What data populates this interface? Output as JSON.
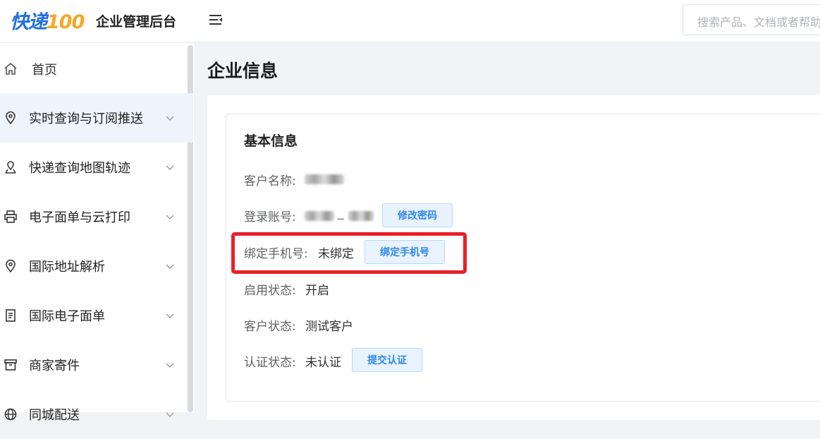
{
  "header": {
    "logo_text_main": "快递",
    "logo_text_num": "100",
    "app_title": "企业管理后台",
    "search_placeholder": "搜索产品、文档或者帮助"
  },
  "sidebar": {
    "items": [
      {
        "label": "首页",
        "icon": "home-icon"
      },
      {
        "label": "实时查询与订阅推送",
        "icon": "location-pin-icon"
      },
      {
        "label": "快递查询地图轨迹",
        "icon": "map-route-icon"
      },
      {
        "label": "电子面单与云打印",
        "icon": "printer-icon"
      },
      {
        "label": "国际地址解析",
        "icon": "location-pin-icon"
      },
      {
        "label": "国际电子面单",
        "icon": "document-icon"
      },
      {
        "label": "商家寄件",
        "icon": "box-icon"
      },
      {
        "label": "同城配送",
        "icon": "globe-icon"
      }
    ]
  },
  "main": {
    "page_title": "企业信息",
    "section_title": "基本信息",
    "rows": {
      "customer_name_label": "客户名称:",
      "login_account_label": "登录账号:",
      "login_account_sep": "_",
      "change_password_button": "修改密码",
      "bind_phone_label": "绑定手机号:",
      "bind_phone_value": "未绑定",
      "bind_phone_button": "绑定手机号",
      "enable_status_label": "启用状态:",
      "enable_status_value": "开启",
      "customer_status_label": "客户状态:",
      "customer_status_value": "测试客户",
      "auth_status_label": "认证状态:",
      "auth_status_value": "未认证",
      "submit_auth_button": "提交认证"
    }
  },
  "colors": {
    "accent": "#2f86ea",
    "highlight": "#e8202a",
    "active_nav_bg": "#eef4fb"
  }
}
